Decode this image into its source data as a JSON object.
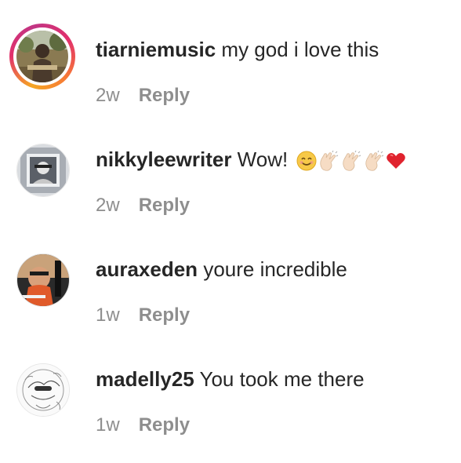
{
  "comments": [
    {
      "username": "tiarniemusic",
      "text": "my god i love this",
      "age": "2w",
      "reply_label": "Reply",
      "avatar": "photo-person-outdoors",
      "story_ring": true
    },
    {
      "username": "nikkyleewriter",
      "text": "Wow!",
      "emojis": [
        "smiling-face-emoji",
        "clapping-hands-emoji",
        "clapping-hands-emoji",
        "clapping-hands-emoji",
        "red-heart-emoji"
      ],
      "age": "2w",
      "reply_label": "Reply",
      "avatar": "photo-portrait-frame"
    },
    {
      "username": "auraxeden",
      "text": "youre incredible",
      "age": "1w",
      "reply_label": "Reply",
      "avatar": "photo-album-cover"
    },
    {
      "username": "madelly25",
      "text": "You took me there",
      "age": "1w",
      "reply_label": "Reply",
      "avatar": "illustration-sketch"
    }
  ],
  "colors": {
    "text": "#262626",
    "secondary": "#8e8e8e",
    "ring_start": "#f5a623",
    "ring_end": "#c13584"
  }
}
